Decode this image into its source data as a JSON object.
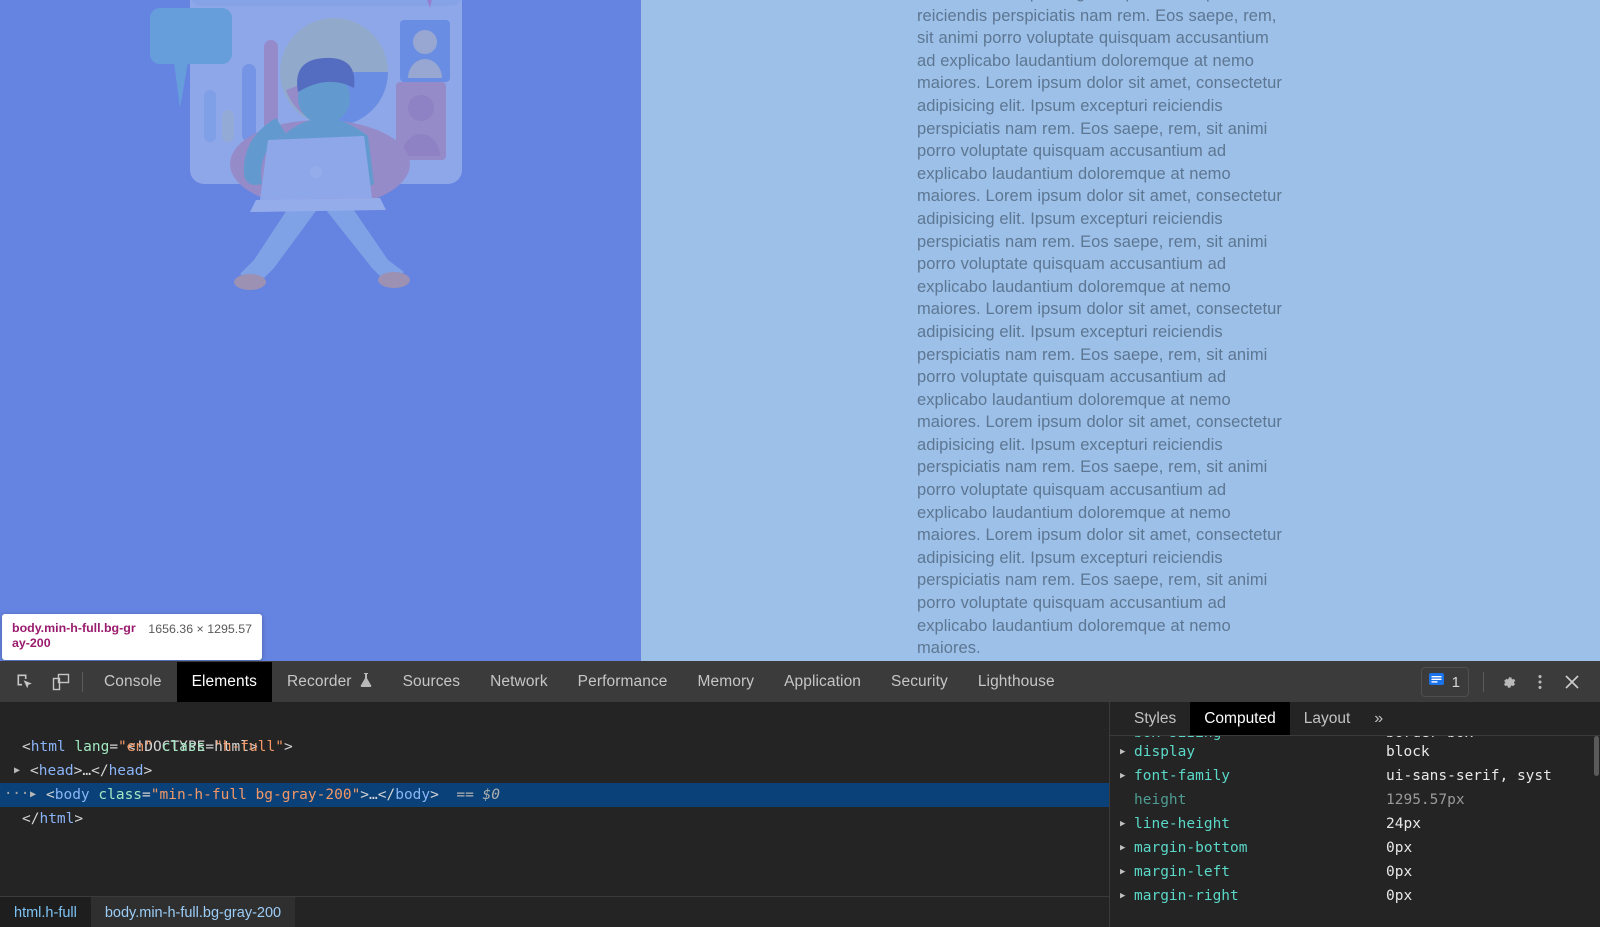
{
  "page": {
    "background_left_color": "#6583e0",
    "background_right_color": "#9cc0e8",
    "text_color": "#5d7692",
    "lorem": "consectetur adipisicing elit. Ipsum excepturi reiciendis perspiciatis nam rem. Eos saepe, rem, sit animi porro voluptate quisquam accusantium ad explicabo laudantium doloremque at nemo maiores. Lorem ipsum dolor sit amet, consectetur adipisicing elit. Ipsum excepturi reiciendis perspiciatis nam rem. Eos saepe, rem, sit animi porro voluptate quisquam accusantium ad explicabo laudantium doloremque at nemo maiores. Lorem ipsum dolor sit amet, consectetur adipisicing elit. Ipsum excepturi reiciendis perspiciatis nam rem. Eos saepe, rem, sit animi porro voluptate quisquam accusantium ad explicabo laudantium doloremque at nemo maiores. Lorem ipsum dolor sit amet, consectetur adipisicing elit. Ipsum excepturi reiciendis perspiciatis nam rem. Eos saepe, rem, sit animi porro voluptate quisquam accusantium ad explicabo laudantium doloremque at nemo maiores. Lorem ipsum dolor sit amet, consectetur adipisicing elit. Ipsum excepturi reiciendis perspiciatis nam rem. Eos saepe, rem, sit animi porro voluptate quisquam accusantium ad explicabo laudantium doloremque at nemo maiores. Lorem ipsum dolor sit amet, consectetur adipisicing elit. Ipsum excepturi reiciendis perspiciatis nam rem. Eos saepe, rem, sit animi porro voluptate quisquam accusantium ad explicabo laudantium doloremque at nemo maiores."
  },
  "inspect_tooltip": {
    "selector": "body.min-h-full.bg-gray-200",
    "dimensions": "1656.36 × 1295.57"
  },
  "devtools": {
    "toolbar_icons": [
      {
        "name": "inspect-element-icon",
        "label": "Inspect element"
      },
      {
        "name": "device-toolbar-icon",
        "label": "Toggle device toolbar"
      }
    ],
    "tabs": [
      {
        "label": "Console",
        "active": false,
        "icon": ""
      },
      {
        "label": "Elements",
        "active": true,
        "icon": ""
      },
      {
        "label": "Recorder",
        "active": false,
        "icon": "flask-icon"
      },
      {
        "label": "Sources",
        "active": false,
        "icon": ""
      },
      {
        "label": "Network",
        "active": false,
        "icon": ""
      },
      {
        "label": "Performance",
        "active": false,
        "icon": ""
      },
      {
        "label": "Memory",
        "active": false,
        "icon": ""
      },
      {
        "label": "Application",
        "active": false,
        "icon": ""
      },
      {
        "label": "Security",
        "active": false,
        "icon": ""
      },
      {
        "label": "Lighthouse",
        "active": false,
        "icon": ""
      }
    ],
    "message_badge": {
      "count": "1",
      "icon": "message-icon",
      "color": "#1a73e8"
    },
    "right_icons": [
      {
        "name": "settings-gear-icon",
        "label": "Settings"
      },
      {
        "name": "more-options-icon",
        "label": "Customize and control DevTools"
      },
      {
        "name": "close-icon",
        "label": "Close DevTools"
      }
    ],
    "dom_tree": [
      {
        "kind": "doctype",
        "text": "<!DOCTYPE html>"
      },
      {
        "kind": "open_tag",
        "tag": "html",
        "attrs": [
          {
            "name": "lang",
            "value": "en"
          },
          {
            "name": "class",
            "value": "h-full"
          }
        ]
      },
      {
        "kind": "collapsed",
        "tag": "head",
        "text": "<head>…</head>"
      },
      {
        "kind": "selected",
        "tag": "body",
        "attrs": [
          {
            "name": "class",
            "value": "min-h-full bg-gray-200"
          }
        ],
        "suffix": ">…</body>",
        "annotation": "== $0"
      },
      {
        "kind": "close_tag",
        "text": "</html>"
      }
    ],
    "breadcrumb": [
      {
        "label": "html.h-full",
        "selected": false
      },
      {
        "label": "body.min-h-full.bg-gray-200",
        "selected": true
      }
    ],
    "sidebar": {
      "tabs": [
        {
          "label": "Styles",
          "active": false
        },
        {
          "label": "Computed",
          "active": true
        },
        {
          "label": "Layout",
          "active": false
        },
        {
          "label": "»",
          "active": false
        }
      ],
      "computed_properties": [
        {
          "name": "box-sizing",
          "value": "border-box",
          "inherited": false,
          "clipped": true
        },
        {
          "name": "display",
          "value": "block",
          "inherited": false,
          "clipped": false
        },
        {
          "name": "font-family",
          "value": "ui-sans-serif, syst",
          "inherited": false,
          "clipped": false
        },
        {
          "name": "height",
          "value": "1295.57px",
          "inherited": true,
          "clipped": false
        },
        {
          "name": "line-height",
          "value": "24px",
          "inherited": false,
          "clipped": false
        },
        {
          "name": "margin-bottom",
          "value": "0px",
          "inherited": false,
          "clipped": false
        },
        {
          "name": "margin-left",
          "value": "0px",
          "inherited": false,
          "clipped": false
        },
        {
          "name": "margin-right",
          "value": "0px",
          "inherited": false,
          "clipped": false
        }
      ]
    }
  }
}
